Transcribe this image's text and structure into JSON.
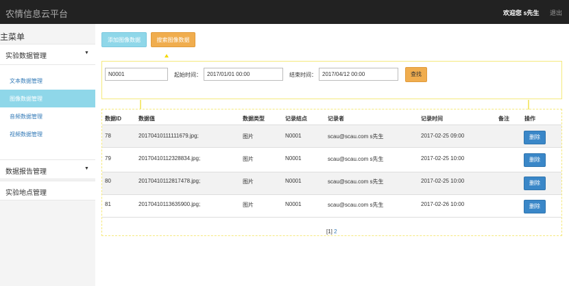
{
  "header": {
    "brand": "农情信息云平台",
    "welcome": "欢迎您 s先生",
    "logout": "退出"
  },
  "sidebar": {
    "title": "主菜单",
    "groups": [
      {
        "label": "实验数据管理",
        "items": [
          "文本数据管理",
          "图像数据管理",
          "音频数据管理",
          "视频数据管理"
        ]
      },
      {
        "label": "数据报告管理"
      },
      {
        "label": "实验地点管理"
      }
    ]
  },
  "toolbar": {
    "add_label": "添加图像数据",
    "search_label": "搜索图像数据"
  },
  "search": {
    "node_value": "N0001",
    "start_label": "起始时间：",
    "start_value": "2017/01/01 00:00",
    "end_label": "结束时间：",
    "end_value": "2017/04/12 00:00",
    "find_label": "查找"
  },
  "table": {
    "headers": [
      "数据ID",
      "数据值",
      "数据类型",
      "记录结点",
      "记录者",
      "记录时间",
      "备注",
      "操作"
    ],
    "delete_label": "删除",
    "rows": [
      [
        "78",
        "20170410111111679.jpg;",
        "图片",
        "N0001",
        "scau@scau.com s先生",
        "2017-02-25 09:00",
        ""
      ],
      [
        "79",
        "20170410112328834.jpg;",
        "图片",
        "N0001",
        "scau@scau.com s先生",
        "2017-02-25 10:00",
        ""
      ],
      [
        "80",
        "20170410112817478.jpg;",
        "图片",
        "N0001",
        "scau@scau.com s先生",
        "2017-02-25 10:00",
        ""
      ],
      [
        "81",
        "20170410113635900.jpg;",
        "图片",
        "N0001",
        "scau@scau.com s先生",
        "2017-02-26 10:00",
        ""
      ]
    ]
  },
  "pagination": {
    "current": "[1]",
    "next": "2"
  }
}
